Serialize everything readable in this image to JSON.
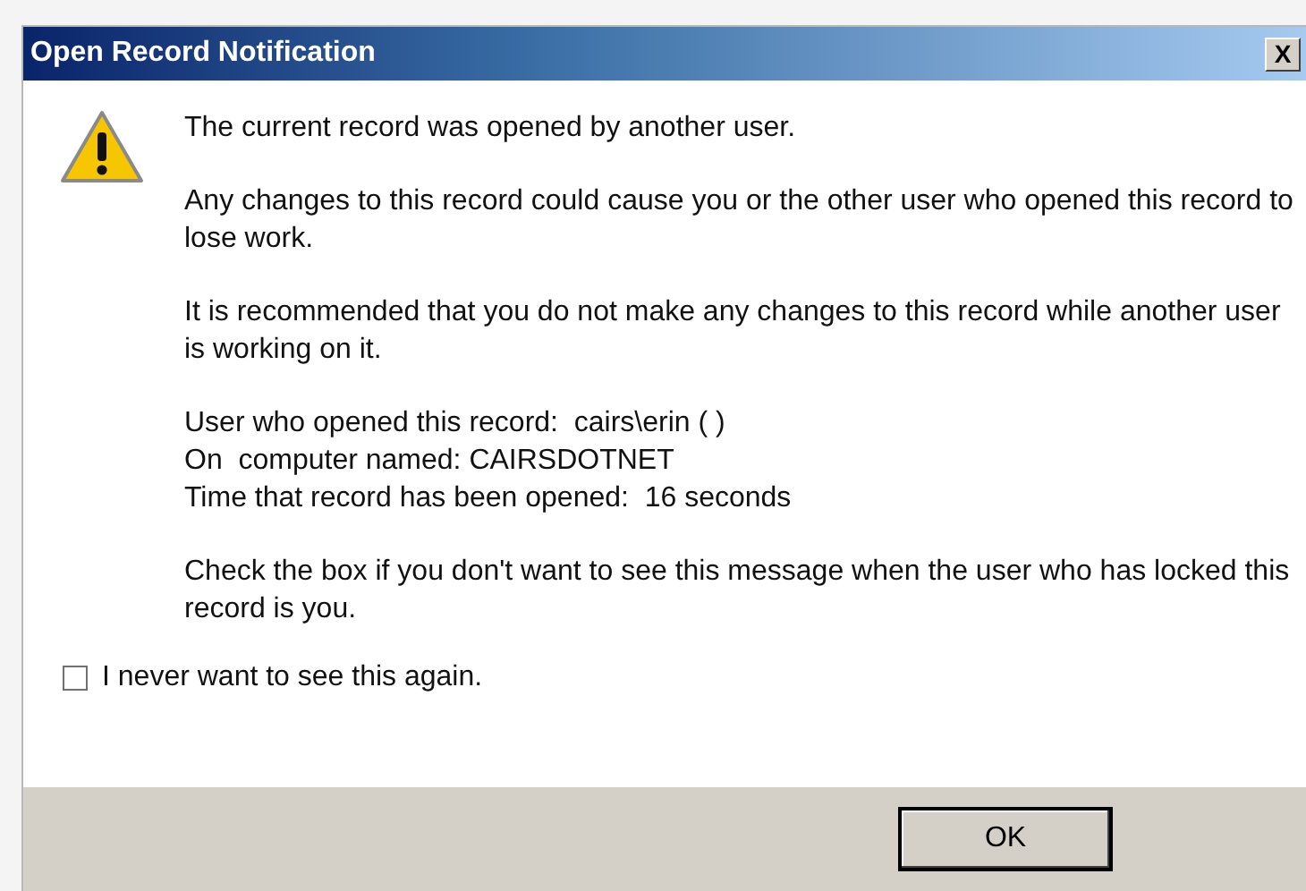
{
  "window": {
    "title": "Open Record Notification",
    "close_label": "X"
  },
  "message": {
    "paragraphs": [
      [
        "The current record was opened by another user."
      ],
      [
        "Any changes to this record could cause you or the other user who opened this record to lose work."
      ],
      [
        "It is recommended that you do not make any changes to this record while another user is working on it."
      ],
      [
        "User who opened this record:  cairs\\erin ( )",
        "On  computer named: CAIRSDOTNET",
        "Time that record has been opened:  16 seconds"
      ],
      [
        "Check the box if you don't want to see this message when the user who has locked this record is you."
      ]
    ]
  },
  "checkbox": {
    "label": "I never want to see this again.",
    "checked": false
  },
  "buttons": [
    {
      "label": "OK"
    }
  ]
}
